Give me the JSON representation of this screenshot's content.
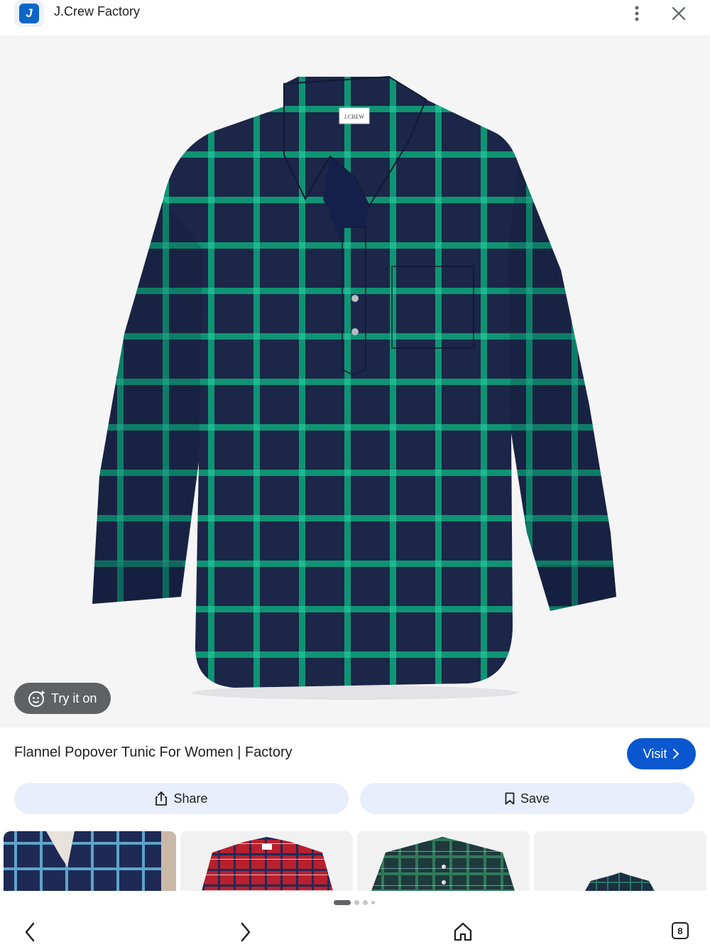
{
  "header": {
    "site_name": "J.Crew Factory",
    "logo_text": "J",
    "logo_icon": "jcrew-logo-icon",
    "menu_icon": "more-vert-icon",
    "close_icon": "close-icon"
  },
  "product": {
    "title": "Flannel Popover Tunic For Women | Factory",
    "image_label": "J.CREW",
    "try_on_label": "Try it on",
    "try_on_icon": "try-on-sparkle-icon",
    "visit_label": "Visit",
    "visit_icon": "chevron-right-icon"
  },
  "actions": {
    "share_label": "Share",
    "share_icon": "share-icon",
    "save_label": "Save",
    "save_icon": "bookmark-icon"
  },
  "related": [
    {
      "name": "navy-plaid-shirt"
    },
    {
      "name": "red-plaid-shirt"
    },
    {
      "name": "green-plaid-ruffle-shirt"
    },
    {
      "name": "green-plaid-shirt"
    }
  ],
  "pagination": {
    "pages": 4,
    "current": 1
  },
  "bottom_nav": {
    "back_icon": "chevron-left-icon",
    "forward_icon": "chevron-right-icon",
    "home_icon": "home-icon",
    "tabs_count": "8"
  },
  "colors": {
    "accent": "#0b57d0",
    "chip_bg": "#e8eefb",
    "image_bg": "#f5f5f6",
    "shirt_navy": "#1b2648",
    "shirt_green": "#0f9473"
  }
}
